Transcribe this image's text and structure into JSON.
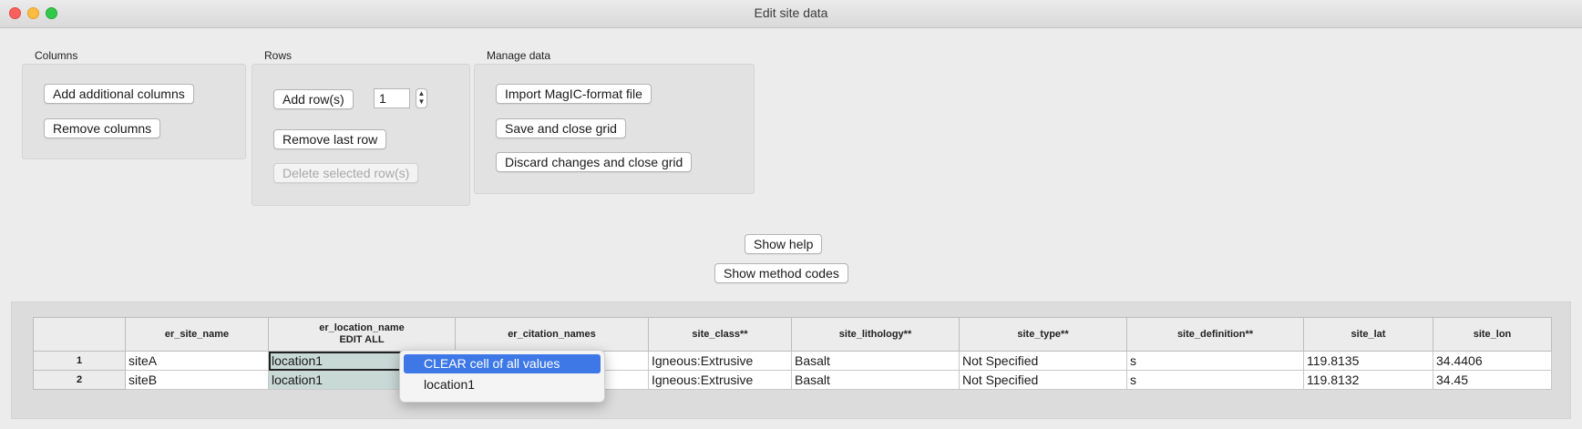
{
  "window": {
    "title": "Edit site data"
  },
  "columns_group": {
    "label": "Columns",
    "add_label": "Add additional columns",
    "remove_label": "Remove columns"
  },
  "rows_group": {
    "label": "Rows",
    "add_label": "Add row(s)",
    "count_value": "1",
    "remove_last_label": "Remove last row",
    "delete_selected_label": "Delete selected row(s)"
  },
  "manage_group": {
    "label": "Manage data",
    "import_label": "Import MagIC-format file",
    "save_label": "Save and close grid",
    "discard_label": "Discard changes and close grid"
  },
  "help": {
    "show_help_label": "Show help",
    "show_method_codes_label": "Show method codes"
  },
  "grid": {
    "headers": [
      "",
      "er_site_name",
      "er_location_name",
      "er_citation_names",
      "site_class**",
      "site_lithology**",
      "site_type**",
      "site_definition**",
      "site_lat",
      "site_lon"
    ],
    "location_edit_all": "EDIT ALL",
    "rows": [
      {
        "num": "1",
        "er_site_name": "siteA",
        "er_location_name": "location1",
        "er_citation_names": "",
        "site_class": "Igneous:Extrusive",
        "site_lithology": "Basalt",
        "site_type": "Not Specified",
        "site_definition": "s",
        "site_lat": "119.8135",
        "site_lon": "34.4406"
      },
      {
        "num": "2",
        "er_site_name": "siteB",
        "er_location_name": "location1",
        "er_citation_names": "",
        "site_class": "Igneous:Extrusive",
        "site_lithology": "Basalt",
        "site_type": "Not Specified",
        "site_definition": "s",
        "site_lat": "119.8132",
        "site_lon": "34.45"
      }
    ]
  },
  "popup_menu": {
    "items": [
      "CLEAR cell of all values",
      "location1"
    ],
    "selected_index": 0
  },
  "colors": {
    "selection_blue": "#3d78e6",
    "location_cell_bg": "#c9d9d6"
  }
}
